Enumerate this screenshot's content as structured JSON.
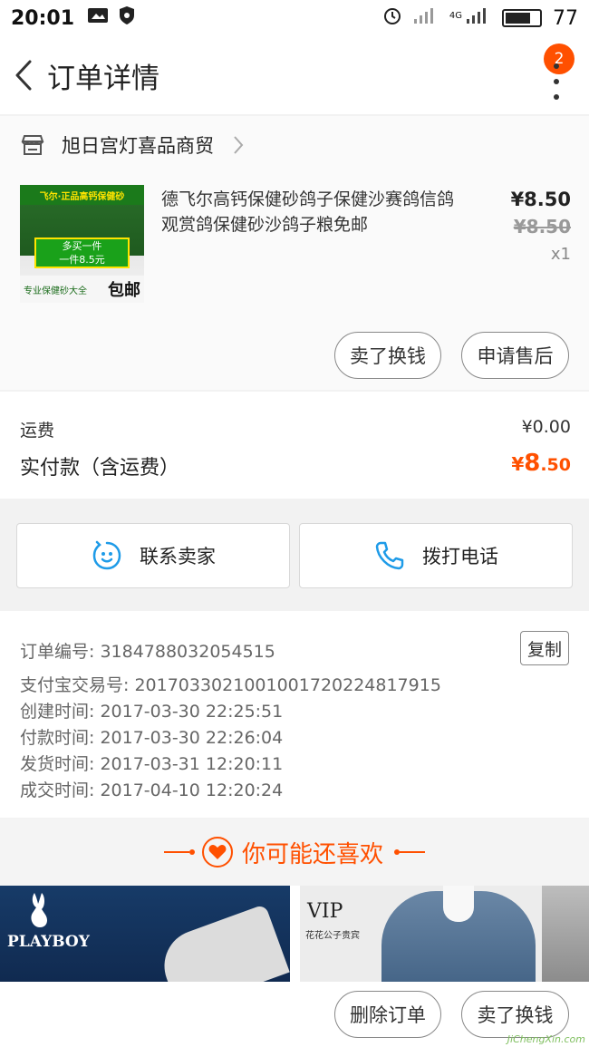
{
  "status_bar": {
    "time": "20:01",
    "network": "4G",
    "battery": "77",
    "battery_level": 0.77
  },
  "nav": {
    "title": "订单详情",
    "badge_count": "2"
  },
  "shop": {
    "name": "旭日宫灯喜品商贸"
  },
  "item": {
    "title": "德飞尔高钙保健砂鸽子保健沙赛鸽信鸽观赏鸽保健砂沙鸽子粮免邮",
    "price": "¥8.50",
    "original_price": "¥8.50",
    "quantity": "x1",
    "thumb_band": "飞尔·正品高钙保健砂",
    "thumb_mid_line1": "多买一件",
    "thumb_mid_line2": "一件8.5元",
    "thumb_foot_text": "专业保健砂大全",
    "thumb_foot_big": "包邮",
    "actions": [
      "卖了换钱",
      "申请售后"
    ]
  },
  "summary": {
    "shipping_label": "运费",
    "shipping_value": "¥0.00",
    "paid_label": "实付款（含运费）",
    "paid_currency": "¥",
    "paid_int": "8",
    "paid_dec": ".50"
  },
  "contact": {
    "seller_label": "联系卖家",
    "phone_label": "拨打电话"
  },
  "order_info": {
    "copy_label": "复制",
    "rows": [
      "订单编号: 3184788032054515",
      "支付宝交易号: 2017033021001001720224817915",
      "创建时间: 2017-03-30 22:25:51",
      "付款时间: 2017-03-30 22:26:04",
      "发货时间: 2017-03-31 12:20:11",
      "成交时间: 2017-04-10 12:20:24"
    ]
  },
  "recommend": {
    "title": "你可能还喜欢",
    "products": [
      {
        "brand": "PLAYBOY"
      },
      {
        "brand": "VIP",
        "sub": "花花公子贵宾"
      }
    ]
  },
  "bottom_bar": {
    "actions": [
      "删除订单",
      "卖了换钱"
    ]
  },
  "watermark": "JiChengXin.com",
  "colors": {
    "accent": "#ff5000",
    "text": "#333333",
    "muted": "#888888",
    "background": "#f2f2f2"
  },
  "icons": [
    "back-icon",
    "more-icon",
    "shop-icon",
    "chevron-right-icon",
    "chat-icon",
    "phone-icon",
    "heart-icon"
  ]
}
